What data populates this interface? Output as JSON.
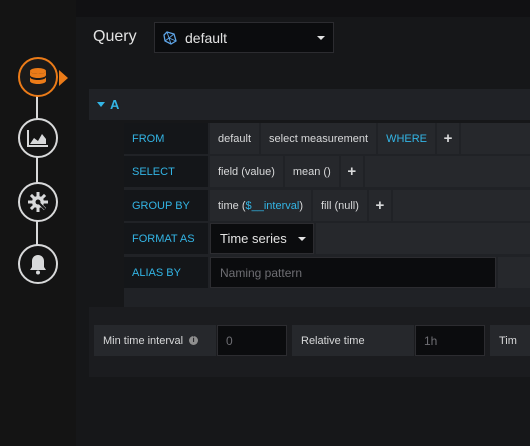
{
  "header": {
    "query_label": "Query",
    "datasource": "default"
  },
  "query_row": {
    "letter": "A"
  },
  "editor": {
    "from": {
      "label": "FROM",
      "policy": "default",
      "measurement": "select measurement",
      "where_label": "WHERE",
      "add": "+"
    },
    "select": {
      "label": "SELECT",
      "field": "field (value)",
      "func": "mean ()",
      "add": "+"
    },
    "group_by": {
      "label": "GROUP BY",
      "time_prefix": "time (",
      "time_var": "$__interval",
      "time_suffix": ")",
      "fill": "fill (null)",
      "add": "+"
    },
    "format_as": {
      "label": "FORMAT AS",
      "value": "Time series"
    },
    "alias_by": {
      "label": "ALIAS BY",
      "placeholder": "Naming pattern"
    }
  },
  "options": {
    "min_interval_label": "Min time interval",
    "min_interval_placeholder": "0",
    "relative_time_label": "Relative time",
    "relative_time_placeholder": "1h",
    "time_shift_label": "Tim"
  },
  "steps": [
    "database-icon",
    "chart-icon",
    "gear-icon",
    "bell-icon"
  ],
  "colors": {
    "accent_blue": "#33b5e5",
    "active_orange": "#eb7b18"
  }
}
